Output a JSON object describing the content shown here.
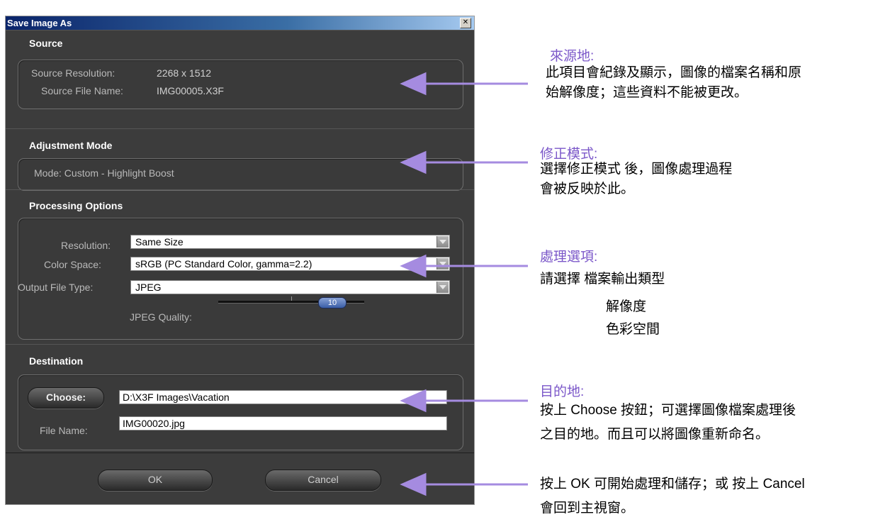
{
  "dialog": {
    "title": "Save Image As",
    "close_symbol": "✕",
    "source": {
      "heading": "Source",
      "resolution_label": "Source Resolution:",
      "resolution_value": "2268 x 1512",
      "filename_label": "Source File Name:",
      "filename_value": "IMG00005.X3F"
    },
    "adjustment": {
      "heading": "Adjustment Mode",
      "mode_text": "Mode: Custom - Highlight Boost"
    },
    "processing": {
      "heading": "Processing Options",
      "resolution_label": "Resolution:",
      "resolution_value": "Same Size",
      "colorspace_label": "Color Space:",
      "colorspace_value": "sRGB (PC Standard Color, gamma=2.2)",
      "filetype_label": "Output File Type:",
      "filetype_value": "JPEG",
      "quality_label": "JPEG Quality:",
      "quality_value": "10"
    },
    "destination": {
      "heading": "Destination",
      "choose_label": "Choose:",
      "path_value": "D:\\X3F Images\\Vacation",
      "filename_label": "File Name:",
      "filename_value": "IMG00020.jpg"
    },
    "buttons": {
      "ok": "OK",
      "cancel": "Cancel"
    }
  },
  "annotations": {
    "source": {
      "title": "來源地:",
      "lines": [
        "此項目會紀錄及顯示，圖像的檔案名稱和原",
        "始解像度；這些資料不能被更改。"
      ]
    },
    "adjustment": {
      "title": "修正模式:",
      "lines": [
        "選擇修正模式 後，圖像處理過程",
        "會被反映於此。"
      ]
    },
    "processing": {
      "title": "處理選項:",
      "lines": [
        "請選擇   檔案輸出類型",
        "解像度",
        "色彩空間"
      ]
    },
    "destination": {
      "title": "目的地:",
      "lines": [
        "按上 Choose 按鈕；可選擇圖像檔案處理後",
        "之目的地。而且可以將圖像重新命名。"
      ]
    },
    "buttons": {
      "lines": [
        "按上 OK  可開始處理和儲存；或 按上 Cancel",
        "會回到主視窗。"
      ]
    },
    "arrow_color": "#a58be0"
  }
}
